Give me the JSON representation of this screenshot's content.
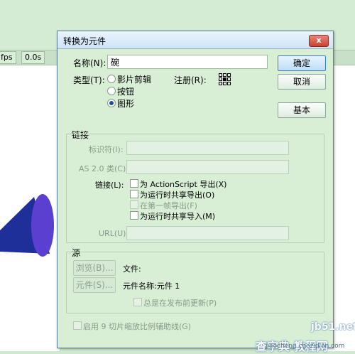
{
  "background": {
    "fps_label": "fps",
    "time_value": "0.0s"
  },
  "dialog": {
    "title": "转换为元件",
    "close_label": "x",
    "name_label": "名称(N):",
    "name_value": "碗",
    "type_label": "类型(T):",
    "type_options": [
      "影片剪辑",
      "按钮",
      "图形"
    ],
    "selected_type": "图形",
    "registration_label": "注册(R):",
    "ok_button": "确定",
    "cancel_button": "取消",
    "basic_button": "基本",
    "linkage": {
      "section_title": "链接",
      "identifier_label": "标识符(I):",
      "as2_class_label": "AS 2.0 类(C):",
      "linkage_label": "链接(L):",
      "options": [
        {
          "label": "为 ActionScript 导出(X)",
          "enabled": true
        },
        {
          "label": "为运行时共享导出(O)",
          "enabled": true
        },
        {
          "label": "在第一帧导出(F)",
          "enabled": false
        },
        {
          "label": "为运行时共享导入(M)",
          "enabled": true
        }
      ],
      "url_label": "URL(U):"
    },
    "source": {
      "section_title": "源",
      "browse_button": "浏览(B)...",
      "symbol_button": "元件(S)...",
      "file_label": "文件:",
      "symbol_name_label": "元件名称:元件 1",
      "always_update_label": "总是在发布前更新(P)"
    },
    "nine_slice_label": "启用 9 切片缩放比例辅助线(G)"
  },
  "watermark": {
    "line1": "jb51.net",
    "line2": "查字典 教程网",
    "line3": "jiaocheng.chazidian.com"
  },
  "colors": {
    "dialog_bg": "#d8efd6",
    "shape_dark": "#1f2f9a",
    "shape_light": "#5b3fd0"
  }
}
